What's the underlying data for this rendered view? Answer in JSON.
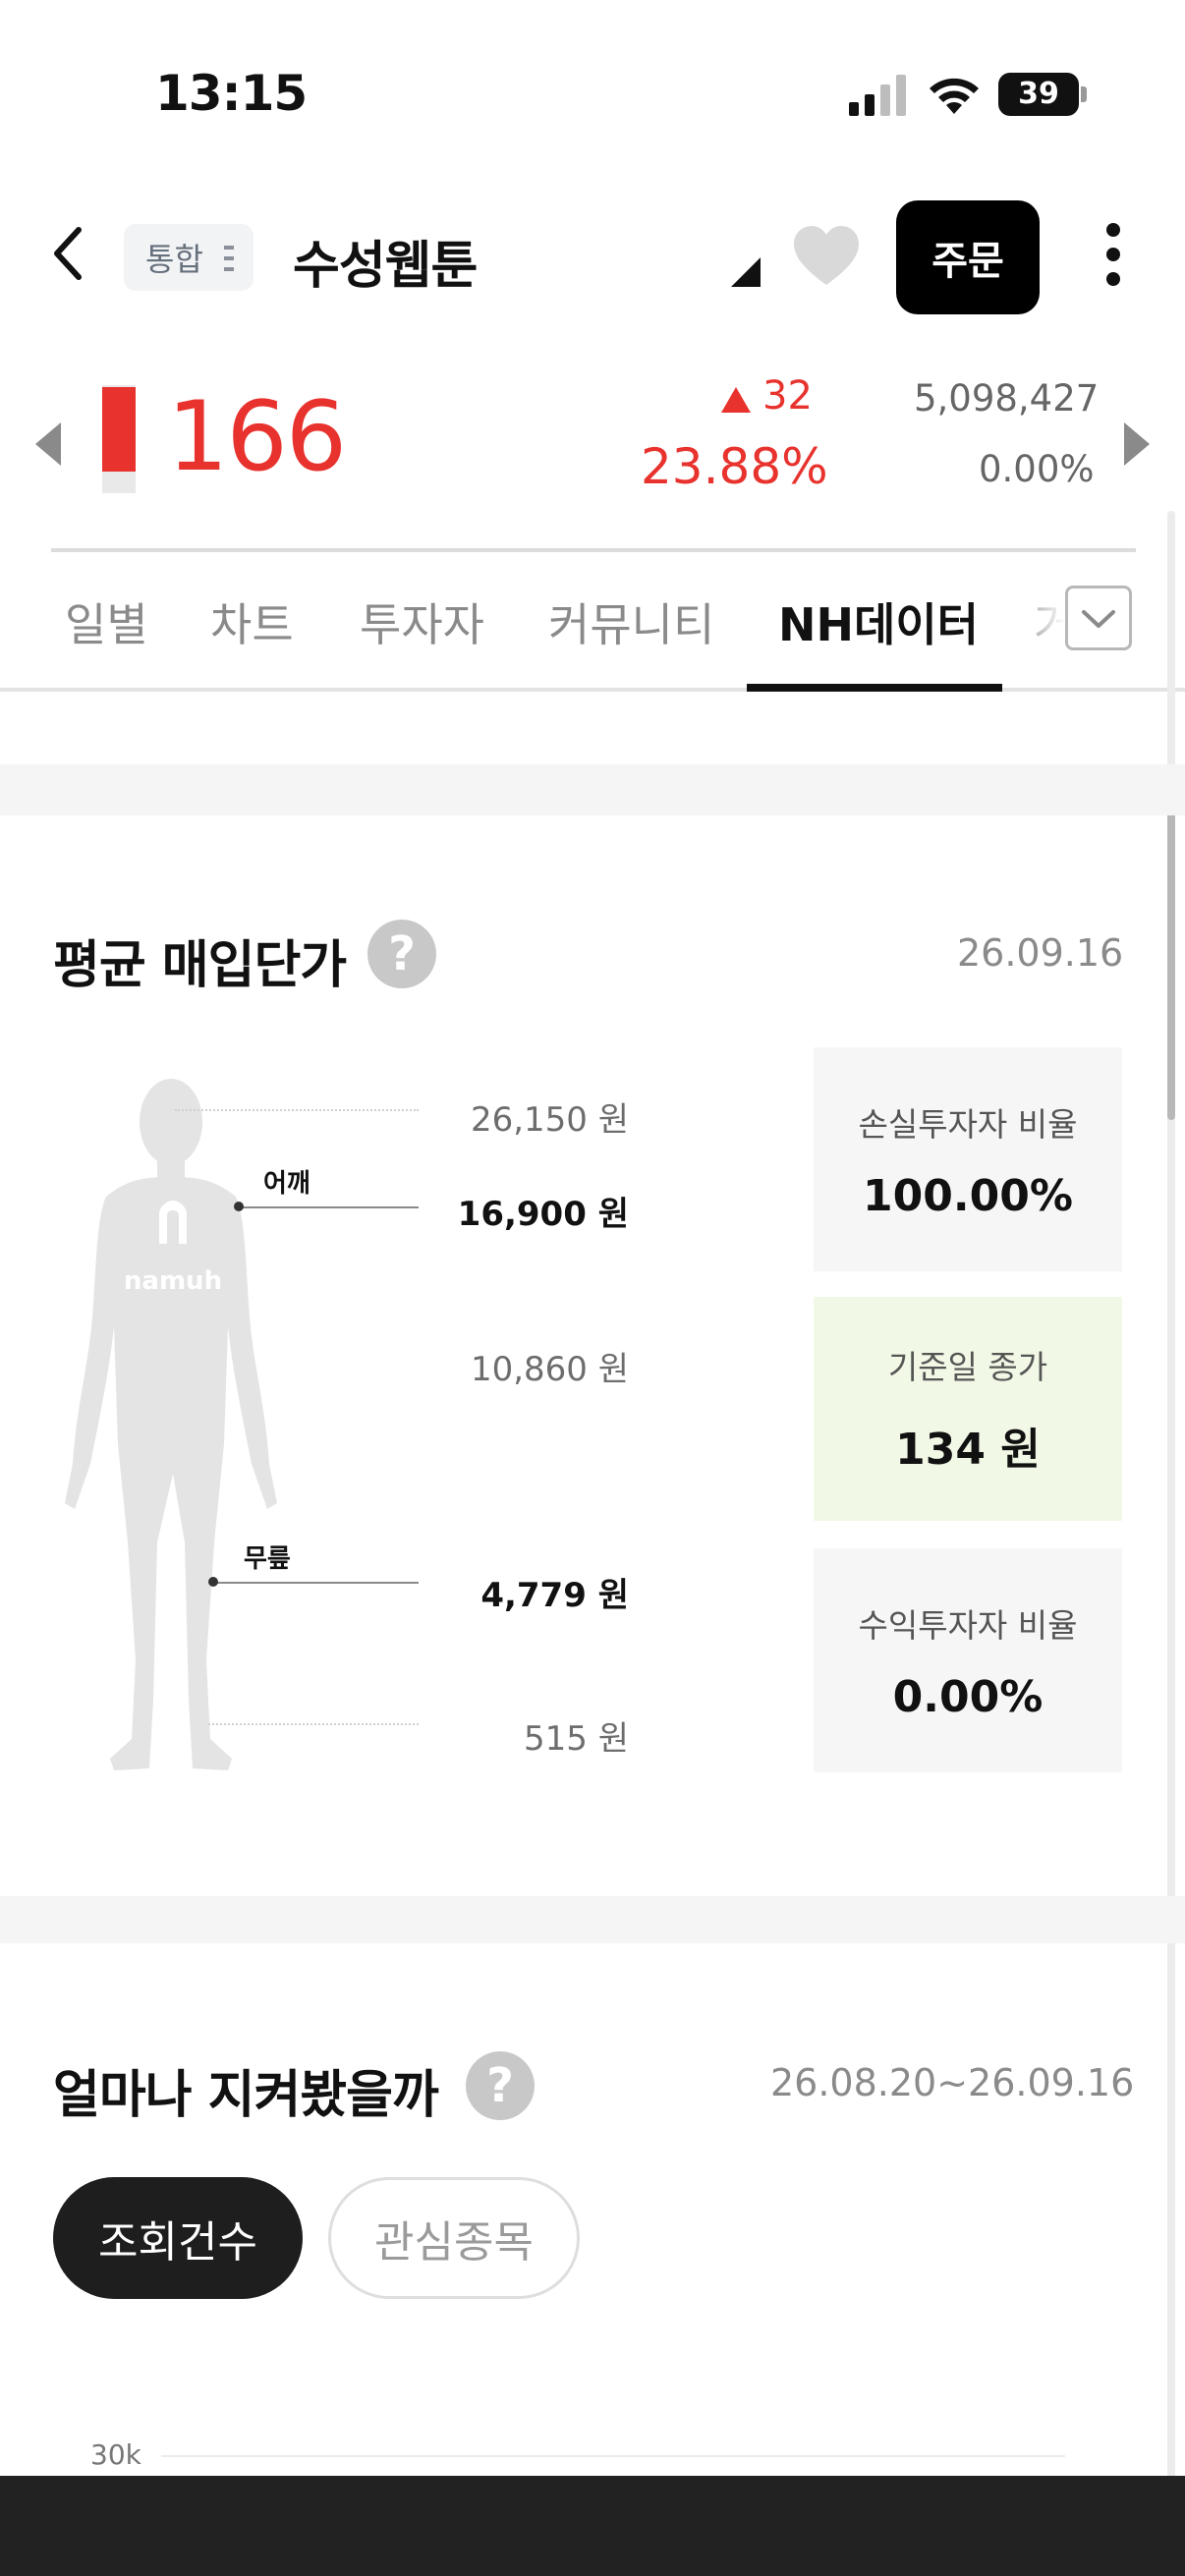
{
  "status_bar": {
    "time": "13:15",
    "battery": "39"
  },
  "header": {
    "badge": "통합",
    "stock_name": "수성웹툰",
    "order_label": "주문"
  },
  "price": {
    "current": "166",
    "change": "32",
    "change_pct": "23.88%",
    "volume": "5,098,427",
    "volume_pct": "0.00%"
  },
  "tabs": [
    "일별",
    "차트",
    "투자자",
    "커뮤니티",
    "NH데이터",
    "거"
  ],
  "active_tab": "NH데이터",
  "avg_price_section": {
    "title": "평균 매입단가",
    "date": "26.09.16",
    "logo": "namuh",
    "points": {
      "shoulder": "어깨",
      "knee": "무릎"
    },
    "levels": [
      "26,150 원",
      "16,900 원",
      "10,860 원",
      "4,779 원",
      "515 원"
    ],
    "cards": [
      {
        "label": "손실투자자 비율",
        "value": "100.00%"
      },
      {
        "label": "기준일 종가",
        "value": "134 원"
      },
      {
        "label": "수익투자자 비율",
        "value": "0.00%"
      }
    ]
  },
  "watch_section": {
    "title": "얼마나 지켜봤을까",
    "date_range": "26.08.20~26.09.16",
    "pills": [
      "조회건수",
      "관심종목"
    ],
    "axis_top": "30k"
  },
  "colors": {
    "up": "#e8322d",
    "dark": "#111111",
    "green_card": "#f1f9e6"
  }
}
